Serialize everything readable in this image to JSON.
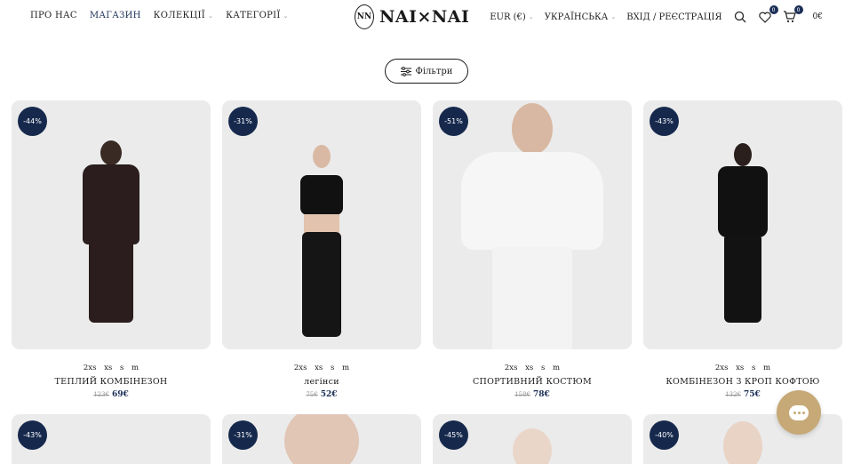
{
  "nav": {
    "left": [
      {
        "label": "ПРО НАС",
        "has_caret": false
      },
      {
        "label": "МАГАЗИН",
        "has_caret": false
      },
      {
        "label": "КОЛЕКЦІЇ",
        "has_caret": true
      },
      {
        "label": "КАТЕГОРІЇ",
        "has_caret": true
      }
    ],
    "logo_text": "NAI×NAI",
    "logo_mark": "NN",
    "currency": "EUR (€)",
    "language": "УКРАЇНСЬКА",
    "account": "ВХІД / РЕЄСТРАЦІЯ",
    "wishlist_count": "0",
    "cart_count": "0",
    "cart_total": "0€"
  },
  "filter": {
    "label": "Фільтри"
  },
  "products": [
    {
      "discount": "-44%",
      "sizes": "2xs xs s m",
      "name": "ТЕПЛИЙ КОМБІНЕЗОН",
      "old_price": "123€",
      "price": "69€"
    },
    {
      "discount": "-31%",
      "sizes": "2xs xs s m",
      "name": "легінси",
      "old_price": "75€",
      "price": "52€"
    },
    {
      "discount": "-51%",
      "sizes": "2xs xs s m",
      "name": "СПОРТИВНИЙ КОСТЮМ",
      "old_price": "158€",
      "price": "78€"
    },
    {
      "discount": "-43%",
      "sizes": "2xs xs s m",
      "name": "КОМБІНЕЗОН З КРОП КОФТОЮ",
      "old_price": "132€",
      "price": "75€"
    }
  ],
  "products_row2": [
    {
      "discount": "-43%"
    },
    {
      "discount": "-31%"
    },
    {
      "discount": "-45%"
    },
    {
      "discount": "-40%"
    }
  ],
  "colors": {
    "accent": "#16294d",
    "chat": "#c6a977"
  }
}
